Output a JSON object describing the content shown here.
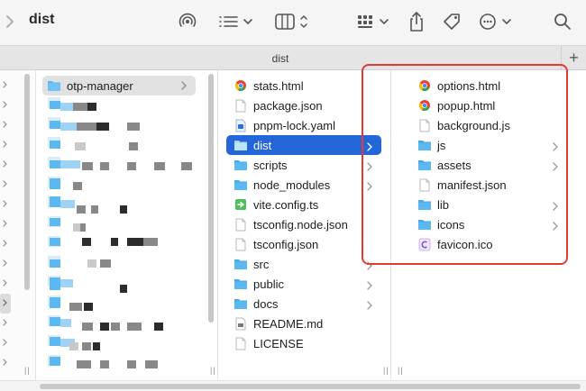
{
  "window": {
    "title": "dist"
  },
  "toolbar": {
    "icons": [
      "back-chevron-icon",
      "airdrop-icon",
      "list-view-icon",
      "column-view-icon",
      "gallery-view-icon",
      "share-icon",
      "tag-icon",
      "more-actions-icon",
      "search-icon"
    ]
  },
  "tabbar": {
    "tab_label": "dist",
    "add_label": "+"
  },
  "column3": {
    "items": [
      {
        "name": "stats.html",
        "icon": "chrome-html-icon",
        "chevron": false
      },
      {
        "name": "package.json",
        "icon": "document-icon",
        "chevron": false
      },
      {
        "name": "pnpm-lock.yaml",
        "icon": "yaml-icon",
        "chevron": false
      },
      {
        "name": "dist",
        "icon": "folder-icon",
        "chevron": true,
        "selected": true
      },
      {
        "name": "scripts",
        "icon": "folder-icon",
        "chevron": true
      },
      {
        "name": "node_modules",
        "icon": "folder-icon",
        "chevron": true
      },
      {
        "name": "vite.config.ts",
        "icon": "ts-config-icon",
        "chevron": false
      },
      {
        "name": "tsconfig.node.json",
        "icon": "document-icon",
        "chevron": false
      },
      {
        "name": "tsconfig.json",
        "icon": "document-icon",
        "chevron": false
      },
      {
        "name": "src",
        "icon": "folder-icon",
        "chevron": true
      },
      {
        "name": "public",
        "icon": "folder-icon",
        "chevron": true
      },
      {
        "name": "docs",
        "icon": "folder-icon",
        "chevron": true
      },
      {
        "name": "README.md",
        "icon": "markdown-icon",
        "chevron": false
      },
      {
        "name": "LICENSE",
        "icon": "document-icon",
        "chevron": false
      }
    ]
  },
  "column2": {
    "first_item": "otp-manager"
  },
  "column4": {
    "items": [
      {
        "name": "options.html",
        "icon": "chrome-html-icon",
        "chevron": false
      },
      {
        "name": "popup.html",
        "icon": "chrome-html-icon",
        "chevron": false
      },
      {
        "name": "background.js",
        "icon": "document-icon",
        "chevron": false
      },
      {
        "name": "js",
        "icon": "folder-icon",
        "chevron": true
      },
      {
        "name": "assets",
        "icon": "folder-icon",
        "chevron": true
      },
      {
        "name": "manifest.json",
        "icon": "document-icon",
        "chevron": false
      },
      {
        "name": "lib",
        "icon": "folder-icon",
        "chevron": true
      },
      {
        "name": "icons",
        "icon": "folder-icon",
        "chevron": true
      },
      {
        "name": "favicon.ico",
        "icon": "ico-icon",
        "chevron": false
      }
    ]
  },
  "colors": {
    "selection": "#2465d8",
    "folder": "#5cb8f0",
    "annotation": "#e53935"
  }
}
